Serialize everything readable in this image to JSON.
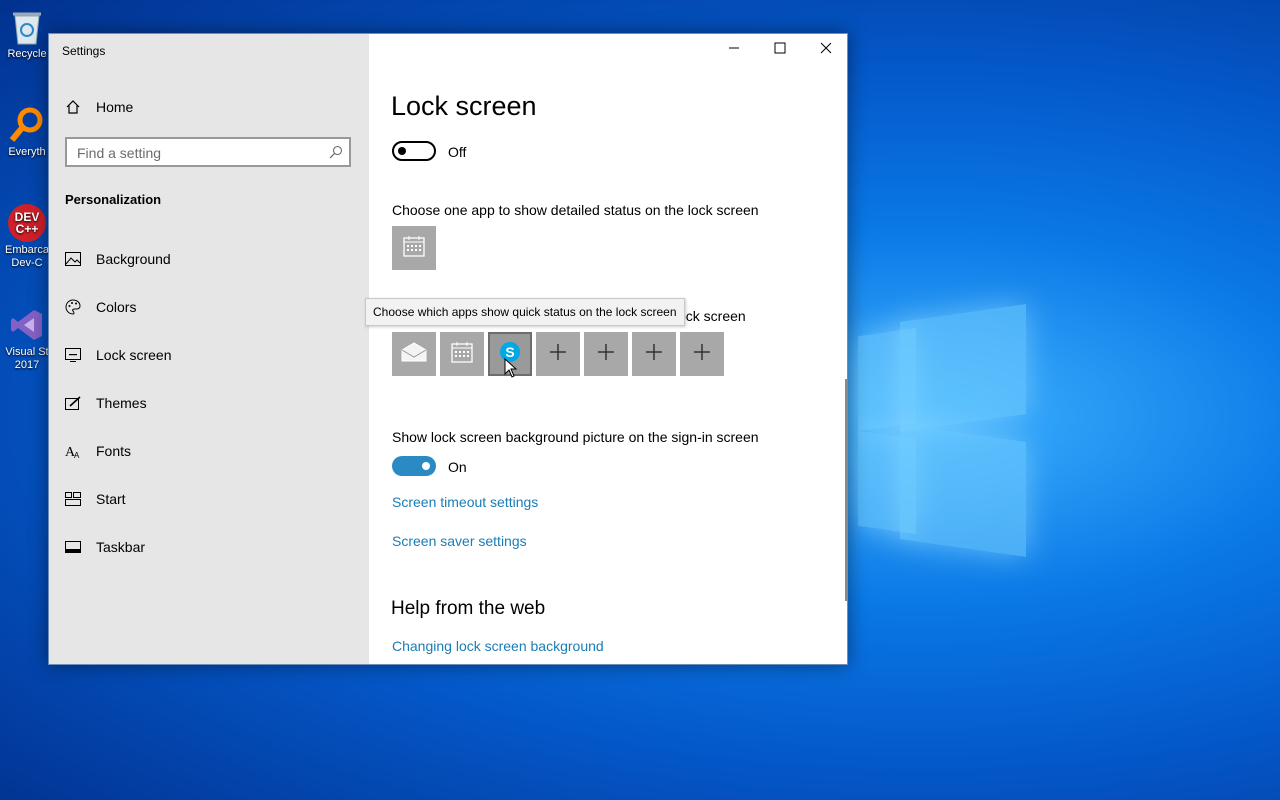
{
  "desktop": {
    "icons": [
      {
        "label": "Recycle",
        "name": "recycle-bin"
      },
      {
        "label": "Everyth",
        "name": "everything"
      },
      {
        "label": "Embarca Dev-C",
        "name": "dev-cpp"
      },
      {
        "label": "Visual St 2017",
        "name": "visual-studio"
      }
    ],
    "devcpp_badge": "DEV C++"
  },
  "window": {
    "title": "Settings",
    "controls": {
      "minimize_icon": "minimize-icon",
      "maximize_icon": "maximize-icon",
      "close_icon": "close-icon"
    }
  },
  "sidebar": {
    "home": "Home",
    "search_placeholder": "Find a setting",
    "section": "Personalization",
    "items": [
      {
        "label": "Background",
        "icon": "picture-icon"
      },
      {
        "label": "Colors",
        "icon": "palette-icon"
      },
      {
        "label": "Lock screen",
        "icon": "lock-screen-icon"
      },
      {
        "label": "Themes",
        "icon": "themes-icon"
      },
      {
        "label": "Fonts",
        "icon": "fonts-icon"
      },
      {
        "label": "Start",
        "icon": "start-icon"
      },
      {
        "label": "Taskbar",
        "icon": "taskbar-icon"
      }
    ]
  },
  "main": {
    "title": "Lock screen",
    "toggle1": {
      "state": "Off"
    },
    "detailed_status_label": "Choose one app to show detailed status on the lock screen",
    "quick_status_label": "Choose which apps show quick status on the lock screen",
    "quick_status_visible_tail": "ock screen",
    "tooltip": "Choose which apps show quick status on the lock screen",
    "quick_tiles": [
      "mail-icon",
      "calendar-icon",
      "skype-icon",
      "plus-icon",
      "plus-icon",
      "plus-icon",
      "plus-icon"
    ],
    "signin_label": "Show lock screen background picture on the sign-in screen",
    "toggle2": {
      "state": "On"
    },
    "links": {
      "timeout": "Screen timeout settings",
      "saver": "Screen saver settings"
    },
    "help_title": "Help from the web",
    "help_links": [
      "Changing lock screen background"
    ]
  },
  "colors": {
    "accent": "#2a8ac4",
    "link": "#1a7db5",
    "sidebar_bg": "#e6e6e6"
  }
}
